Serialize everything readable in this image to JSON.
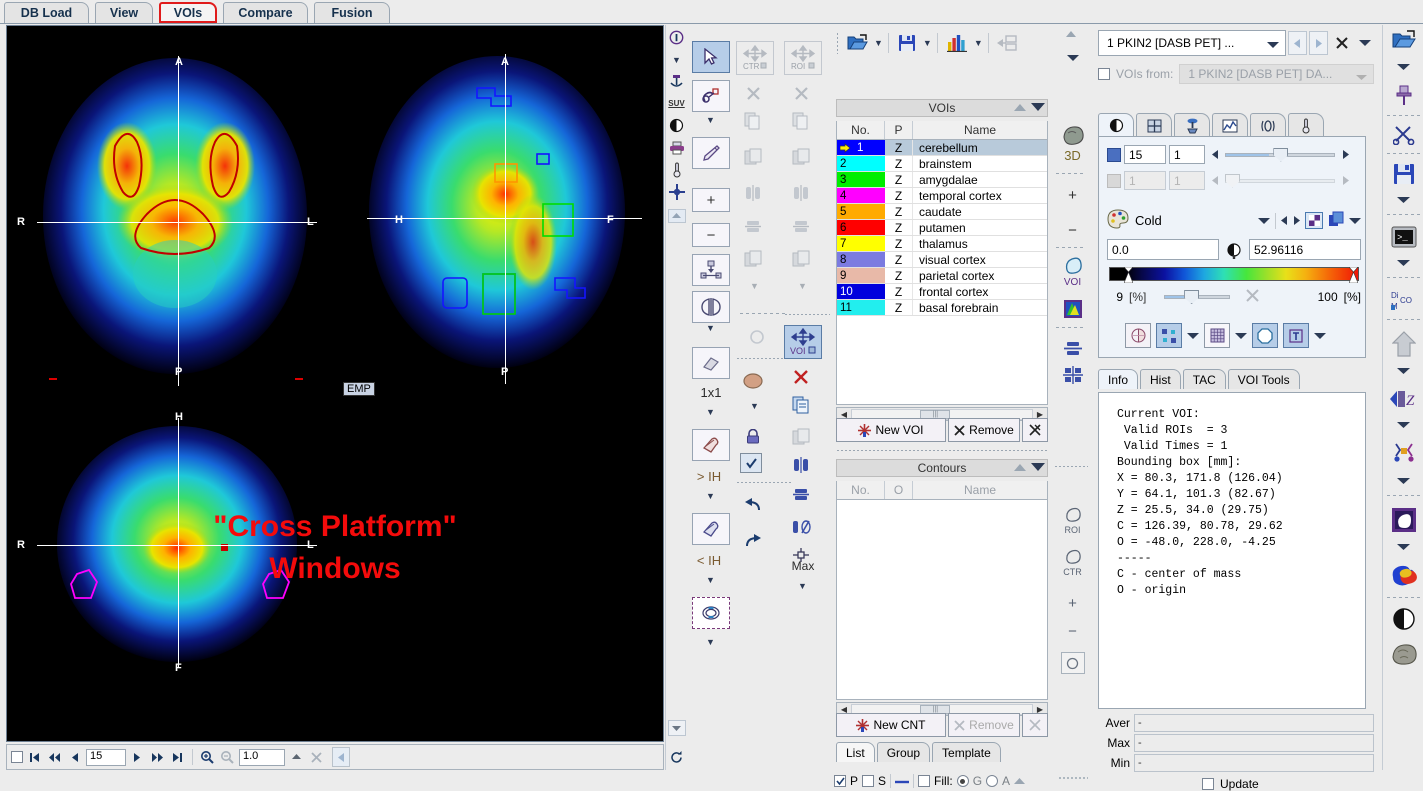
{
  "app": {
    "main_tabs": [
      {
        "label": "DB Load",
        "selected": false
      },
      {
        "label": "View",
        "selected": false
      },
      {
        "label": "VOIs",
        "selected": true
      },
      {
        "label": "Compare",
        "selected": false
      },
      {
        "label": "Fusion",
        "selected": false
      }
    ]
  },
  "image_view": {
    "overlay_badge": "EMP",
    "overlay_title_line1": "\"Cross Platform\"",
    "overlay_title_line2": "Windows",
    "orientation_labels": {
      "transverse": {
        "top": "A",
        "bottom": "P",
        "left": "R",
        "right": "L"
      },
      "sagittal": {
        "top": "A",
        "bottom": "P",
        "left": "H",
        "right": "F"
      },
      "coronal": {
        "top": "H",
        "bottom": "F",
        "left": "R",
        "right": "L"
      }
    },
    "nav": {
      "slice_value": "15",
      "zoom_value": "1.0"
    }
  },
  "tools": {
    "eraser_size_label": "1x1",
    "threshold_above_label": "> IH",
    "threshold_below_label": "< IH",
    "max_label": "Max",
    "ctr_label": "CTR",
    "roi_label": "ROI",
    "voi_label": "VOI",
    "three_d_label": "3D"
  },
  "voi_panel": {
    "title": "VOIs",
    "columns": [
      "No.",
      "P",
      "Name"
    ],
    "rows": [
      {
        "no": "1",
        "p": "Z",
        "name": "cerebellum",
        "color": "#0000ff",
        "selected": true
      },
      {
        "no": "2",
        "p": "Z",
        "name": "brainstem",
        "color": "#00ffff",
        "selected": false
      },
      {
        "no": "3",
        "p": "Z",
        "name": "amygdalae",
        "color": "#00ee00",
        "selected": false
      },
      {
        "no": "4",
        "p": "Z",
        "name": "temporal cortex",
        "color": "#ff00ff",
        "selected": false
      },
      {
        "no": "5",
        "p": "Z",
        "name": "caudate",
        "color": "#ffaa00",
        "selected": false
      },
      {
        "no": "6",
        "p": "Z",
        "name": "putamen",
        "color": "#ff0000",
        "selected": false
      },
      {
        "no": "7",
        "p": "Z",
        "name": "thalamus",
        "color": "#ffff00",
        "selected": false
      },
      {
        "no": "8",
        "p": "Z",
        "name": "visual cortex",
        "color": "#7b7be0",
        "selected": false
      },
      {
        "no": "9",
        "p": "Z",
        "name": "parietal cortex",
        "color": "#e8b9a8",
        "selected": false
      },
      {
        "no": "10",
        "p": "Z",
        "name": "frontal cortex",
        "color": "#0000dd",
        "selected": false
      },
      {
        "no": "11",
        "p": "Z",
        "name": "basal forebrain",
        "color": "#22eeee",
        "selected": false
      }
    ],
    "new_voi_label": "New VOI",
    "remove_label": "Remove"
  },
  "contours_panel": {
    "title": "Contours",
    "columns": [
      "No.",
      "O",
      "Name"
    ],
    "rows": [],
    "new_cnt_label": "New CNT",
    "remove_label": "Remove"
  },
  "bottom_tabs": [
    {
      "label": "List",
      "selected": true
    },
    {
      "label": "Group",
      "selected": false
    },
    {
      "label": "Template",
      "selected": false
    }
  ],
  "bottom_controls": {
    "p_label": "P",
    "p_checked": true,
    "s_label": "S",
    "s_checked": false,
    "fill_label": "Fill:",
    "fill_checked": false,
    "fill_g_label": "G",
    "fill_g_selected": true,
    "fill_a_label": "A",
    "fill_a_selected": false
  },
  "right_panel": {
    "series_selected": "1 PKIN2 [DASB PET] ...",
    "vois_from_label": "VOIs from:",
    "vois_from_value": "1 PKIN2 [DASB PET] DA...",
    "vois_from_checked": false,
    "prop_tabs": [
      {
        "name": "contrast-tab",
        "selected": true
      },
      {
        "name": "layout-tab",
        "selected": false
      },
      {
        "name": "filter-tab",
        "selected": false
      },
      {
        "name": "curve-tab",
        "selected": false
      },
      {
        "name": "atlas-tab",
        "selected": false
      },
      {
        "name": "thermometer-tab",
        "selected": false
      }
    ],
    "slice_row": {
      "value": "15",
      "value2": "1"
    },
    "frame_row": {
      "value": "1",
      "value2": "1",
      "disabled": true
    },
    "palette_name": "Cold",
    "min_value": "0.0",
    "max_value": "52.96116",
    "percent_low": "9",
    "percent_low_unit": "[%]",
    "percent_high": "100",
    "percent_high_unit": "[%]",
    "info_tabs": [
      {
        "label": "Info",
        "selected": true
      },
      {
        "label": "Hist",
        "selected": false
      },
      {
        "label": "TAC",
        "selected": false
      },
      {
        "label": "VOI Tools",
        "selected": false
      }
    ],
    "info_text": "Current VOI:\n Valid ROIs  = 3\n Valid Times = 1\nBounding box [mm]:\nX = 80.3, 171.8 (126.04)\nY = 64.1, 101.3 (82.67)\nZ = 25.5, 34.0 (29.75)\nC = 126.39, 80.78, 29.62\nO = -48.0, 228.0, -4.25\n-----\nC - center of mass\nO - origin",
    "stats": [
      {
        "label": "Aver",
        "value": "-"
      },
      {
        "label": "Max",
        "value": "-"
      },
      {
        "label": "Min",
        "value": "-"
      }
    ],
    "update_label": "Update",
    "update_checked": false
  },
  "colors": {
    "accent_red": "#e01b1b",
    "panel_bg": "#ececec",
    "selection_blue": "#b8cada",
    "overlay_red": "#f40b0b"
  }
}
